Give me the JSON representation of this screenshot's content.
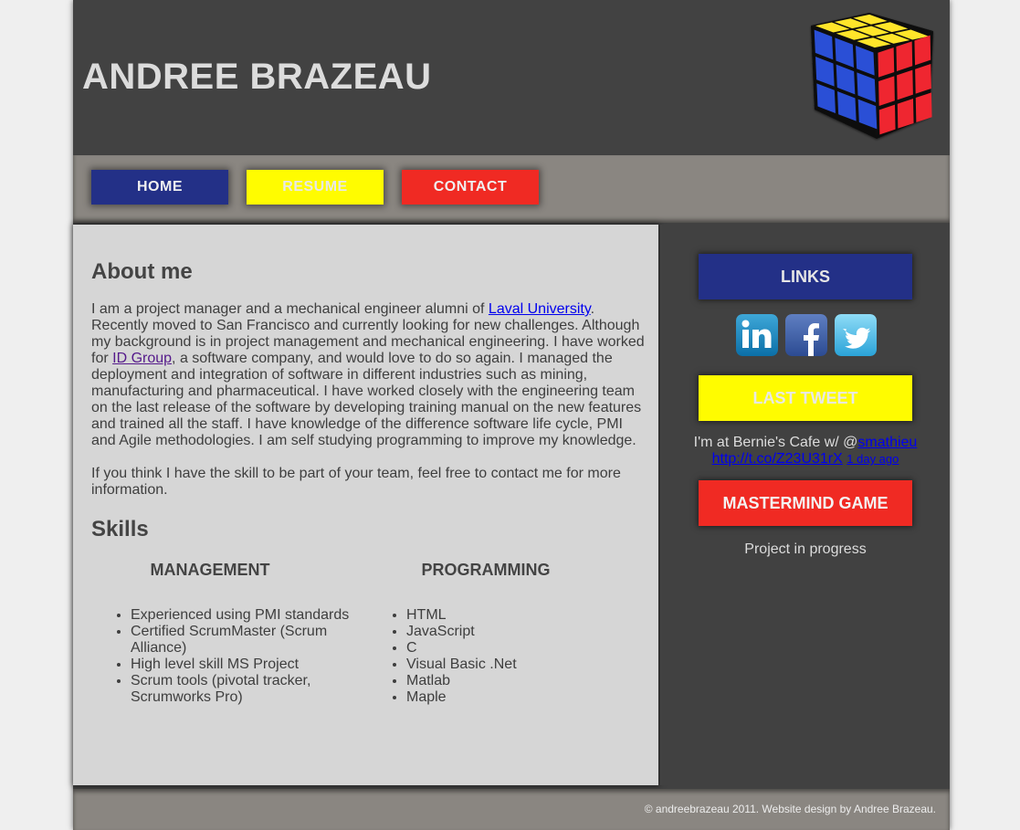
{
  "header": {
    "title": "ANDREE BRAZEAU",
    "logo_icon": "rubiks-cube-icon"
  },
  "nav": {
    "items": [
      {
        "label": "HOME",
        "color": "#233087"
      },
      {
        "label": "RESUME",
        "color": "#fffc00"
      },
      {
        "label": "CONTACT",
        "color": "#f02a23"
      }
    ]
  },
  "about": {
    "heading": "About me",
    "intro_before_link": "I am a project manager and a mechanical engineer alumni of ",
    "university_link": "Laval University",
    "text_middle": ". Recently moved to San Francisco and currently looking for new challenges. Although my background is in project management and mechanical engineering. I have worked for ",
    "company_link": "ID Group",
    "text_after": ", a software company, and would love to do so again. I managed the deployment and integration of software in different industries such as mining, manufacturing and pharmaceutical. I have worked closely with the engineering team on the last release of the software by developing training manual on the new features and trained all the staff. I have knowledge of the difference software life cycle, PMI and Agile methodologies. I am self studying programming to improve my knowledge.",
    "contact_paragraph": "If you think I have the skill to be part of your team, feel free to contact me for more information."
  },
  "skills": {
    "heading": "Skills",
    "management": {
      "title": "MANAGEMENT",
      "items": [
        "Experienced using PMI standards",
        "Certified ScrumMaster (Scrum Alliance)",
        "High level skill MS Project",
        "Scrum tools (pivotal tracker, Scrumworks Pro)"
      ]
    },
    "programming": {
      "title": "PROGRAMMING",
      "items": [
        "HTML",
        "JavaScript",
        "C",
        "Visual Basic .Net",
        "Matlab",
        "Maple"
      ]
    }
  },
  "sidebar": {
    "links_label": "LINKS",
    "social_icons": [
      "linkedin-icon",
      "facebook-icon",
      "twitter-icon"
    ],
    "last_tweet_label": "LAST TWEET",
    "tweet": {
      "text": "I'm at Bernie's Cafe w/ @",
      "mention": "smathieu",
      "url": "http://t.co/Z23U31rX",
      "time": "1 day ago"
    },
    "mastermind_label": "MASTERMIND GAME",
    "mastermind_status": "Project in progress"
  },
  "footer": {
    "copyright": "© andreebrazeau 2011. Website design by Andree Brazeau."
  }
}
